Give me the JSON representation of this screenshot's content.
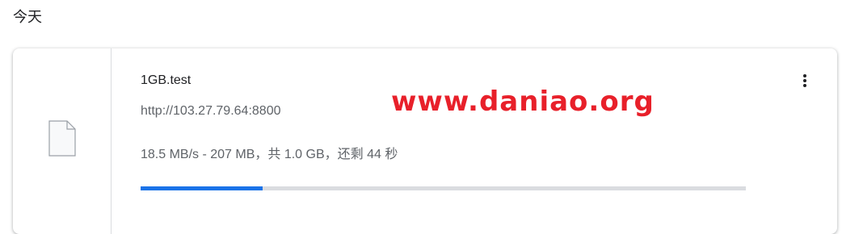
{
  "section": {
    "day_heading": "今天"
  },
  "download": {
    "file_name": "1GB.test",
    "url": "http://103.27.79.64:8800",
    "status_text": "18.5 MB/s - 207 MB，共 1.0 GB，还剩 44 秒",
    "progress_fraction": 0.202,
    "icons": {
      "file": "file-icon",
      "more": "more-vertical-icon"
    }
  },
  "watermark": {
    "text": "www.daniao.org"
  },
  "colors": {
    "progress": "#1a73e8",
    "track": "#dadce0",
    "watermark": "#e8202a"
  }
}
